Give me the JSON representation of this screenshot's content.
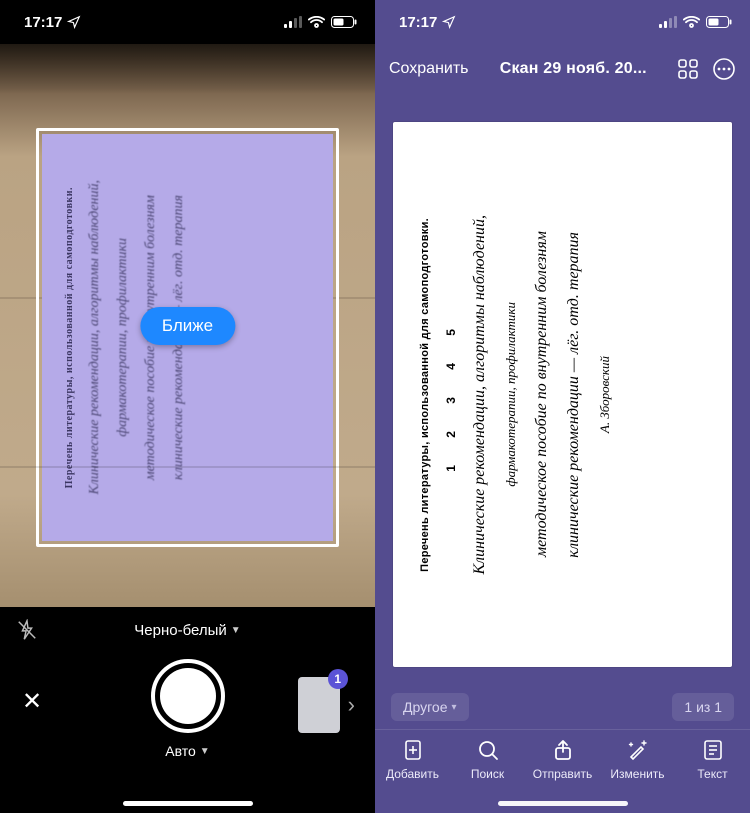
{
  "status": {
    "time": "17:17",
    "location_arrow": "↗"
  },
  "left": {
    "hint": "Ближе",
    "color_mode": "Черно-белый",
    "capture_mode": "Авто",
    "thumb_count": "1"
  },
  "right": {
    "save": "Сохранить",
    "title": "Скан 29 нояб. 20...",
    "category": "Другое",
    "page_indicator": "1 из 1",
    "tabs": {
      "add": "Добавить",
      "search": "Поиск",
      "send": "Отправить",
      "edit": "Изменить",
      "text": "Текст"
    }
  },
  "doc": {
    "heading": "Перечень литературы, использованной для самоподготовки.",
    "numbers": "1  2  3  4  5",
    "lines": [
      "Клинические рекомендации, алгоритмы наблюдений,",
      "фармакотерапии, профилактики",
      "методическое пособие по внутренним болезням",
      "клинические рекомендации — лёг. отд. терапия",
      "А. Зборовский"
    ]
  }
}
